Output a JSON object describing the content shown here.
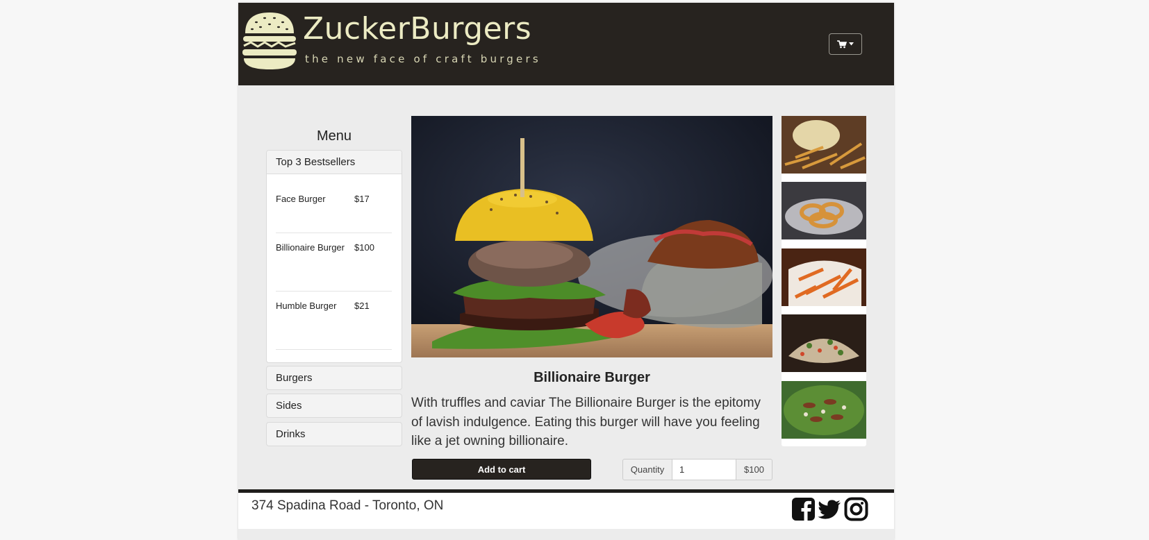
{
  "brand": {
    "name": "ZuckerBurgers",
    "tagline": "the new face of craft burgers"
  },
  "header": {
    "cart_icon": "shopping-cart-icon"
  },
  "sidebar": {
    "title": "Menu",
    "bestsellers": {
      "heading": "Top 3 Bestsellers",
      "items": [
        {
          "name": "Face Burger",
          "price": "$17"
        },
        {
          "name": "Billionaire Burger",
          "price": "$100"
        },
        {
          "name": "Humble Burger",
          "price": "$21"
        }
      ]
    },
    "categories": [
      "Burgers",
      "Sides",
      "Drinks"
    ]
  },
  "product": {
    "title": "Billionaire Burger",
    "description": "With truffles and caviar The Billionaire Burger is the epitomy of lavish indulgence. Eating this burger will have you feeling like a jet owning billionaire.",
    "add_to_cart": "Add to cart",
    "quantity_label": "Quantity",
    "quantity_value": "1",
    "price": "$100"
  },
  "thumbnails": [
    "fries-with-dip",
    "onion-rings",
    "sweet-potato-fries",
    "loaded-nachos",
    "salad"
  ],
  "footer": {
    "address": "374 Spadina Road - Toronto, ON",
    "social": [
      "facebook-icon",
      "twitter-icon",
      "instagram-icon"
    ]
  },
  "colors": {
    "header_bg": "#27231f",
    "logo_cream": "#ecebc3",
    "page_bg": "#ececec"
  }
}
